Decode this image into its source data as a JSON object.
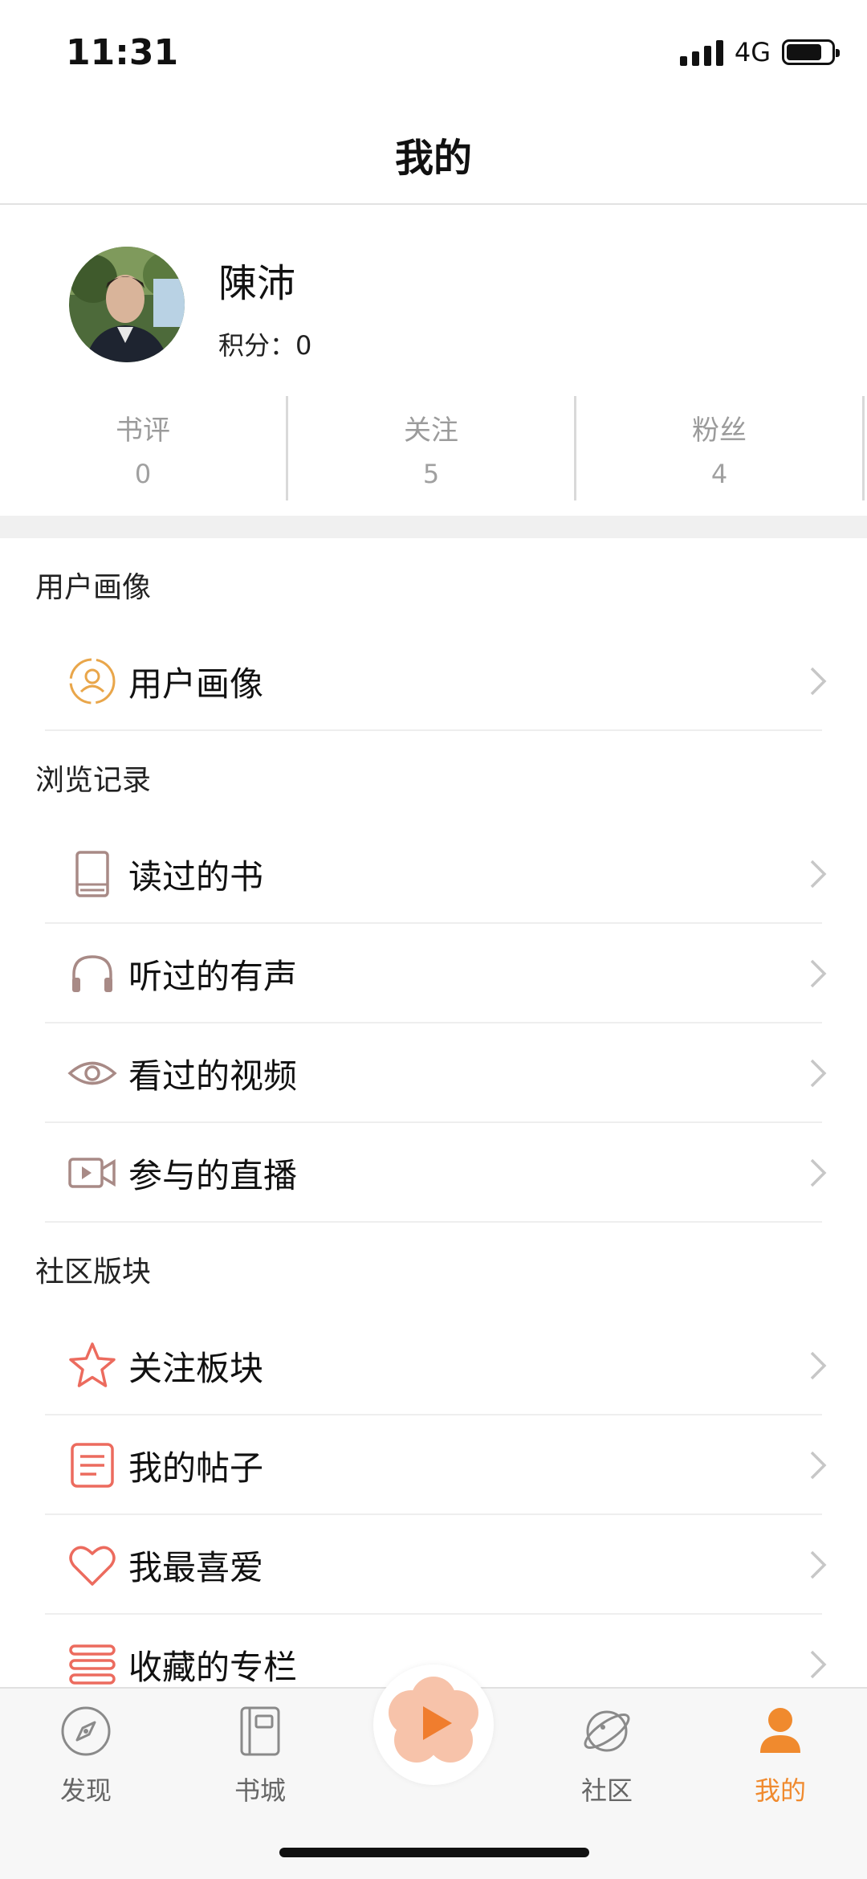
{
  "status": {
    "time": "11:31",
    "network": "4G",
    "battery_level": 0.8
  },
  "nav": {
    "title": "我的"
  },
  "profile": {
    "name": "陳沛",
    "points_label": "积分：",
    "points_value": "0",
    "stats": [
      {
        "label": "书评",
        "value": "0"
      },
      {
        "label": "关注",
        "value": "5"
      },
      {
        "label": "粉丝",
        "value": "4"
      }
    ]
  },
  "sections": [
    {
      "title": "用户画像",
      "items": [
        {
          "label": "用户画像",
          "icon": "user-portrait-icon"
        }
      ]
    },
    {
      "title": "浏览记录",
      "items": [
        {
          "label": "读过的书",
          "icon": "book-icon"
        },
        {
          "label": "听过的有声",
          "icon": "headphones-icon"
        },
        {
          "label": "看过的视频",
          "icon": "eye-icon"
        },
        {
          "label": "参与的直播",
          "icon": "video-camera-icon"
        }
      ]
    },
    {
      "title": "社区版块",
      "items": [
        {
          "label": "关注板块",
          "icon": "star-icon"
        },
        {
          "label": "我的帖子",
          "icon": "document-icon"
        },
        {
          "label": "我最喜爱",
          "icon": "heart-icon"
        },
        {
          "label": "收藏的专栏",
          "icon": "list-icon"
        }
      ]
    }
  ],
  "tabs": [
    {
      "label": "发现",
      "icon": "compass-icon"
    },
    {
      "label": "书城",
      "icon": "notebook-icon"
    },
    {
      "label": "",
      "icon": "play-icon"
    },
    {
      "label": "社区",
      "icon": "planet-icon"
    },
    {
      "label": "我的",
      "icon": "person-icon",
      "active": true
    }
  ],
  "colors": {
    "accent": "#f08a2e",
    "icon_brown": "#a88a86",
    "icon_red": "#ec6b5e",
    "icon_orange": "#e9a64a"
  }
}
